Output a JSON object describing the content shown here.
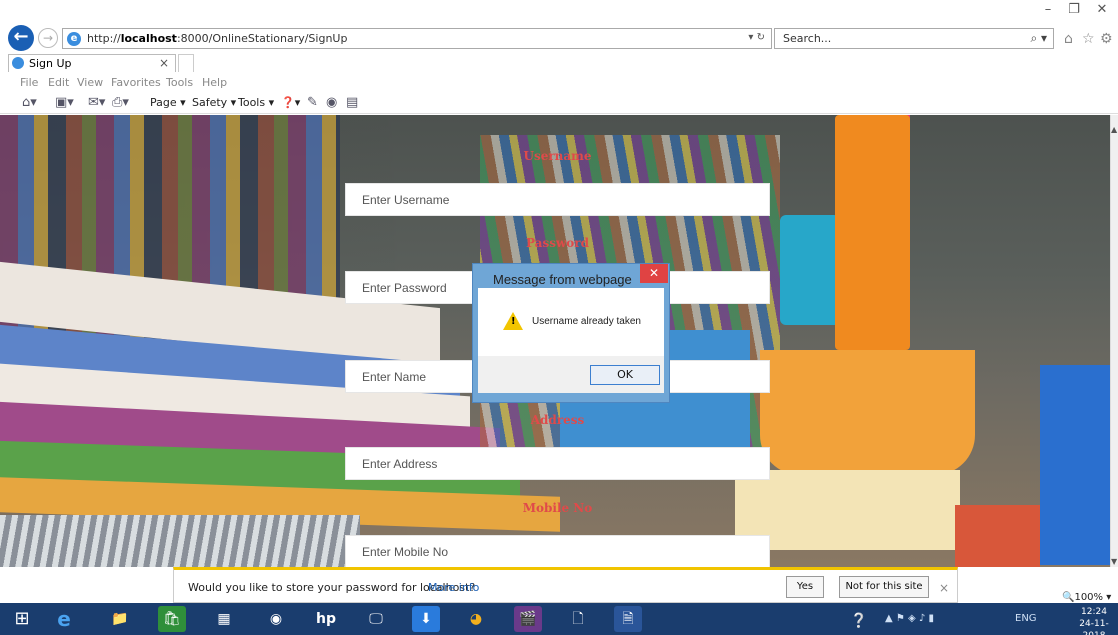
{
  "window": {
    "minimize": "–",
    "restore": "❐",
    "close": "✕"
  },
  "browser": {
    "url_prefix": "http://",
    "url_host": "localhost",
    "url_rest": ":8000/OnlineStationary/SignUp",
    "url_controls": "▾ ↻",
    "search_placeholder": "Search...",
    "search_icon": "⌕ ▾",
    "home_icon": "⌂",
    "favorites_icon": "☆",
    "settings_icon": "⚙",
    "back_icon": "←",
    "forward_icon": "→",
    "ie_icon": "e"
  },
  "tab": {
    "label": "Sign Up",
    "close": "×"
  },
  "menu": [
    "File",
    "Edit",
    "View",
    "Favorites",
    "Tools",
    "Help"
  ],
  "commandbar": {
    "page": "Page ▾",
    "safety": "Safety ▾",
    "tools": "Tools ▾",
    "help_icon": "❓▾"
  },
  "form": {
    "username_label": "Username",
    "username_placeholder": "Enter Username",
    "password_label": "Password",
    "password_placeholder": "Enter Password",
    "name_placeholder": "Enter Name",
    "address_label": "Address",
    "address_placeholder": "Enter Address",
    "mobile_label": "Mobile No",
    "mobile_placeholder": "Enter Mobile No"
  },
  "dialog": {
    "title": "Message from webpage",
    "close": "✕",
    "message": "Username already taken",
    "ok": "OK",
    "warn_mark": "!"
  },
  "notification": {
    "text": "Would you like to store your password for localhost?",
    "more_info": "More info",
    "yes": "Yes",
    "not_for_site": "Not for this site",
    "close": "×"
  },
  "zoom": "🔍100% ▾",
  "taskbar": {
    "time": "12:24",
    "date": "24-11-2018",
    "lang": "ENG",
    "apps": [
      "⊞",
      "e",
      "📁",
      "🛍",
      "▦",
      "◉",
      "hp",
      "🖵",
      "⬇",
      "◕",
      "🎬",
      "🗋",
      "🗎"
    ]
  },
  "colors": {
    "accent": "#1a5fb4",
    "label_red": "#e04a4a",
    "taskbar": "#1a3d6e",
    "dialog_frame": "#6fa6d6"
  }
}
